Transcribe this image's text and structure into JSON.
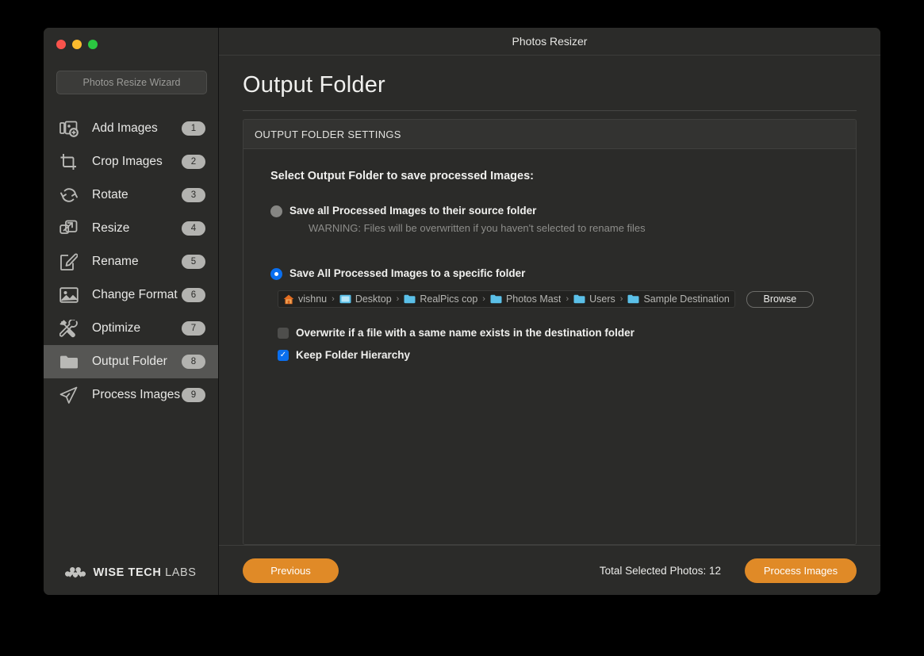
{
  "window": {
    "title": "Photos Resizer",
    "traffic_lights": [
      "close-red",
      "minimize-yellow",
      "maximize-green"
    ]
  },
  "sidebar": {
    "wizard_button": "Photos Resize Wizard",
    "items": [
      {
        "label": "Add Images",
        "badge": "1",
        "icon": "add-images-icon",
        "active": false
      },
      {
        "label": "Crop Images",
        "badge": "2",
        "icon": "crop-icon",
        "active": false
      },
      {
        "label": "Rotate",
        "badge": "3",
        "icon": "rotate-icon",
        "active": false
      },
      {
        "label": "Resize",
        "badge": "4",
        "icon": "resize-icon",
        "active": false
      },
      {
        "label": "Rename",
        "badge": "5",
        "icon": "rename-icon",
        "active": false
      },
      {
        "label": "Change Format",
        "badge": "6",
        "icon": "image-icon",
        "active": false
      },
      {
        "label": "Optimize",
        "badge": "7",
        "icon": "tools-icon",
        "active": false
      },
      {
        "label": "Output Folder",
        "badge": "8",
        "icon": "folder-icon",
        "active": true
      },
      {
        "label": "Process Images",
        "badge": "9",
        "icon": "paper-plane-icon",
        "active": false
      }
    ],
    "brand": {
      "bold": "WISE TECH",
      "light": "LABS",
      "mark": "wise-tech-labs-logo"
    }
  },
  "main": {
    "page_title": "Output Folder",
    "panel_header": "OUTPUT FOLDER SETTINGS",
    "intro": "Select Output Folder to save processed Images:",
    "option_source": {
      "label": "Save all Processed Images to their source folder",
      "selected": false,
      "warning": "WARNING: Files will be overwritten if you haven't selected to rename files"
    },
    "option_specific": {
      "label": "Save All Processed Images to a specific folder",
      "selected": true
    },
    "path": {
      "crumbs": [
        {
          "name": "vishnu",
          "icon": "home-icon"
        },
        {
          "name": "Desktop",
          "icon": "desktop-folder-icon"
        },
        {
          "name": "RealPics cop",
          "icon": "folder-blue-icon"
        },
        {
          "name": "Photos Mast",
          "icon": "folder-blue-icon"
        },
        {
          "name": "Users",
          "icon": "folder-blue-icon"
        },
        {
          "name": "Sample Destination",
          "icon": "folder-blue-icon"
        }
      ],
      "separator": "›",
      "browse_label": "Browse"
    },
    "checkbox_overwrite": {
      "label": "Overwrite if a file with a same name exists in the destination folder",
      "checked": false
    },
    "checkbox_hierarchy": {
      "label": "Keep Folder Hierarchy",
      "checked": true,
      "check_glyph": "✓"
    }
  },
  "footer": {
    "previous_label": "Previous",
    "total_text": "Total Selected Photos: 12",
    "process_label": "Process Images"
  },
  "colors": {
    "accent_orange": "#e08a27",
    "accent_blue": "#0a6fef",
    "window_bg": "#2b2b29",
    "active_row": "#565654",
    "folder_blue": "#5bc0e8"
  }
}
